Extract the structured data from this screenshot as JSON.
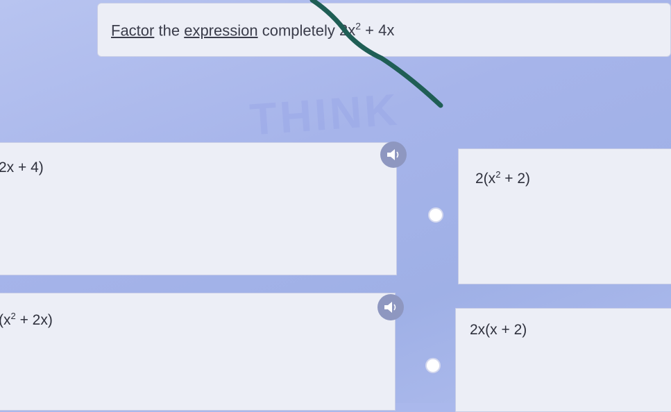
{
  "question": {
    "w1": "Factor",
    "w2": "the",
    "w3": "expression",
    "w4": "completely",
    "expr_base": "2x",
    "expr_exp": "2",
    "expr_rest": " + 4x"
  },
  "watermark": "THINK",
  "answers": {
    "a1": "2x + 4)",
    "a2_pre": "(x",
    "a2_exp": "2",
    "a2_post": " + 2x)",
    "b1_pre": "2(x",
    "b1_exp": "2",
    "b1_post": " + 2)",
    "b2": "2x(x + 2)"
  },
  "icons": {
    "audio": "speaker-icon",
    "choice": "radio-circle"
  },
  "colors": {
    "background": "#aab8ec",
    "card": "#eceef6",
    "text": "#2e303c",
    "pen": "#1f5e55"
  }
}
